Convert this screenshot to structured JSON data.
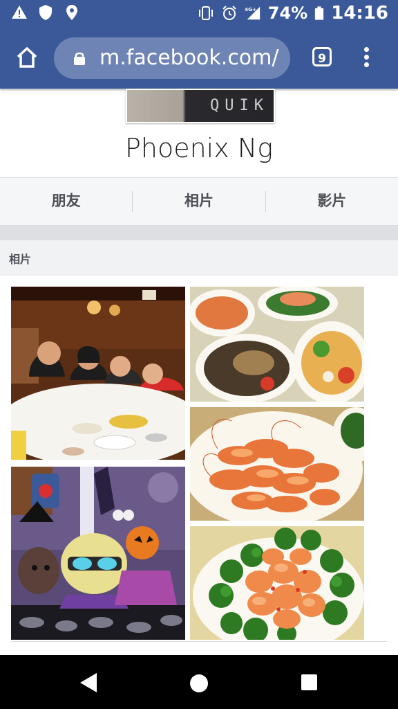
{
  "status_bar": {
    "left_icons": [
      "warning-icon",
      "shield-icon",
      "location-icon"
    ],
    "right_icons": [
      "vibrate-icon",
      "alarm-icon",
      "signal-4g-icon",
      "battery-icon"
    ],
    "network_label": "4G+",
    "battery": "74%",
    "time": "14:16"
  },
  "browser": {
    "url": "m.facebook.com/",
    "tab_count": "9"
  },
  "profile": {
    "name": "Phoenix Ng",
    "photo_text": "QUIK"
  },
  "nav": {
    "items": [
      {
        "label": "朋友"
      },
      {
        "label": "相片"
      },
      {
        "label": "影片"
      }
    ]
  },
  "photos_section": {
    "title": "相片",
    "photos": [
      {
        "name": "family-dinner-photo"
      },
      {
        "name": "seafood-dishes-photo"
      },
      {
        "name": "prawns-photo"
      },
      {
        "name": "halloween-cartoon-photo"
      },
      {
        "name": "shrimp-broccoli-photo"
      }
    ]
  },
  "colors": {
    "brand": "#3b5998",
    "pill": "#6d84b4",
    "text": "#1c1e21"
  }
}
